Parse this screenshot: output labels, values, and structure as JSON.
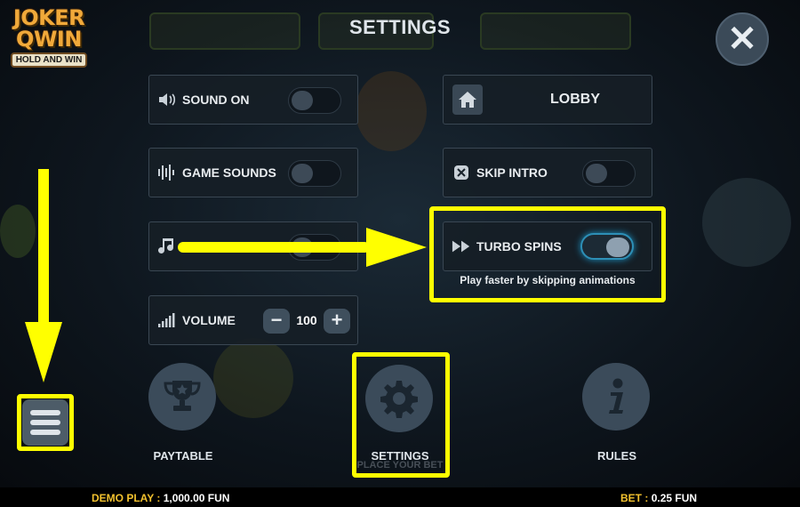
{
  "game": {
    "logo_line1": "JOKER",
    "logo_line2": "QWIN",
    "logo_line3": "HOLD AND WIN"
  },
  "settings": {
    "title": "SETTINGS",
    "sound_on_label": "SOUND ON",
    "sound_on_state": "off",
    "game_sounds_label": "GAME SOUNDS",
    "game_sounds_state": "off",
    "music_state": "off",
    "volume_label": "VOLUME",
    "volume_value": "100",
    "volume_minus": "−",
    "volume_plus": "+",
    "lobby_label": "LOBBY",
    "skip_intro_label": "SKIP INTRO",
    "skip_intro_state": "off",
    "turbo_label": "TURBO SPINS",
    "turbo_state": "on",
    "turbo_desc": "Play faster by skipping animations"
  },
  "nav": {
    "paytable_label": "PAYTABLE",
    "settings_label": "SETTINGS",
    "rules_label": "RULES",
    "place_bet_text": "PLACE YOUR BET"
  },
  "footer": {
    "demo_label": "DEMO PLAY :",
    "demo_value": "1,000.00 FUN",
    "bet_label": "BET :",
    "bet_value": "0.25 FUN"
  },
  "colors": {
    "highlight": "#ffff00",
    "footer_key": "#f2c12e",
    "toggle_on_glow": "#1a91c2"
  },
  "icons": [
    "close-icon",
    "speaker-icon",
    "equalizer-icon",
    "music-note-icon",
    "volume-bars-icon",
    "home-icon",
    "skip-icon",
    "fast-forward-icon",
    "trophy-icon",
    "gear-icon",
    "info-icon",
    "hamburger-menu-icon",
    "arrow-down-icon",
    "arrow-right-icon"
  ]
}
